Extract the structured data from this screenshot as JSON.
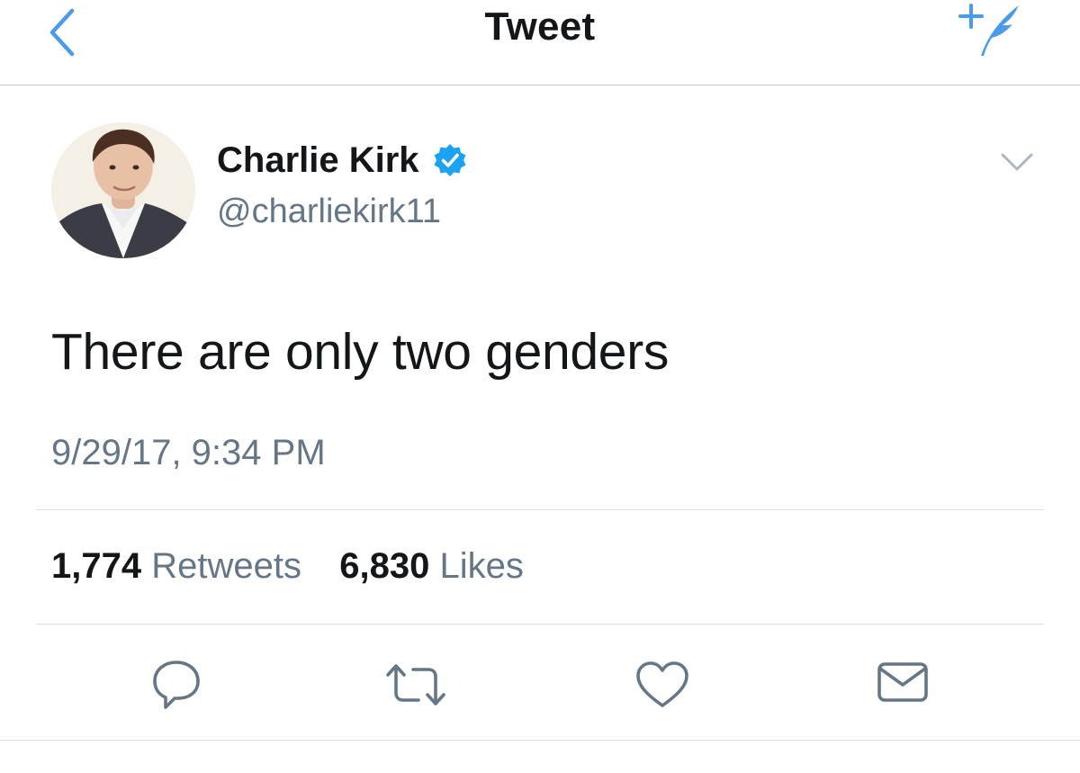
{
  "nav": {
    "title": "Tweet",
    "back_icon": "chevron-left-icon",
    "compose_icon": "compose-tweet-icon",
    "accent_color": "#4a9be8"
  },
  "tweet": {
    "author": {
      "name": "Charlie Kirk",
      "handle": "@charliekirk11",
      "verified": true,
      "verified_color": "#1da1f2"
    },
    "text": "There are only two genders",
    "timestamp": "9/29/17, 9:34 PM",
    "stats": {
      "retweets_count": "1,774",
      "retweets_label": "Retweets",
      "likes_count": "6,830",
      "likes_label": "Likes"
    },
    "actions": [
      "reply-icon",
      "retweet-icon",
      "like-icon",
      "direct-message-icon"
    ]
  },
  "colors": {
    "text": "#14171a",
    "secondary_text": "#657786",
    "divider": "#d9dde1",
    "action_icon": "#657786"
  }
}
